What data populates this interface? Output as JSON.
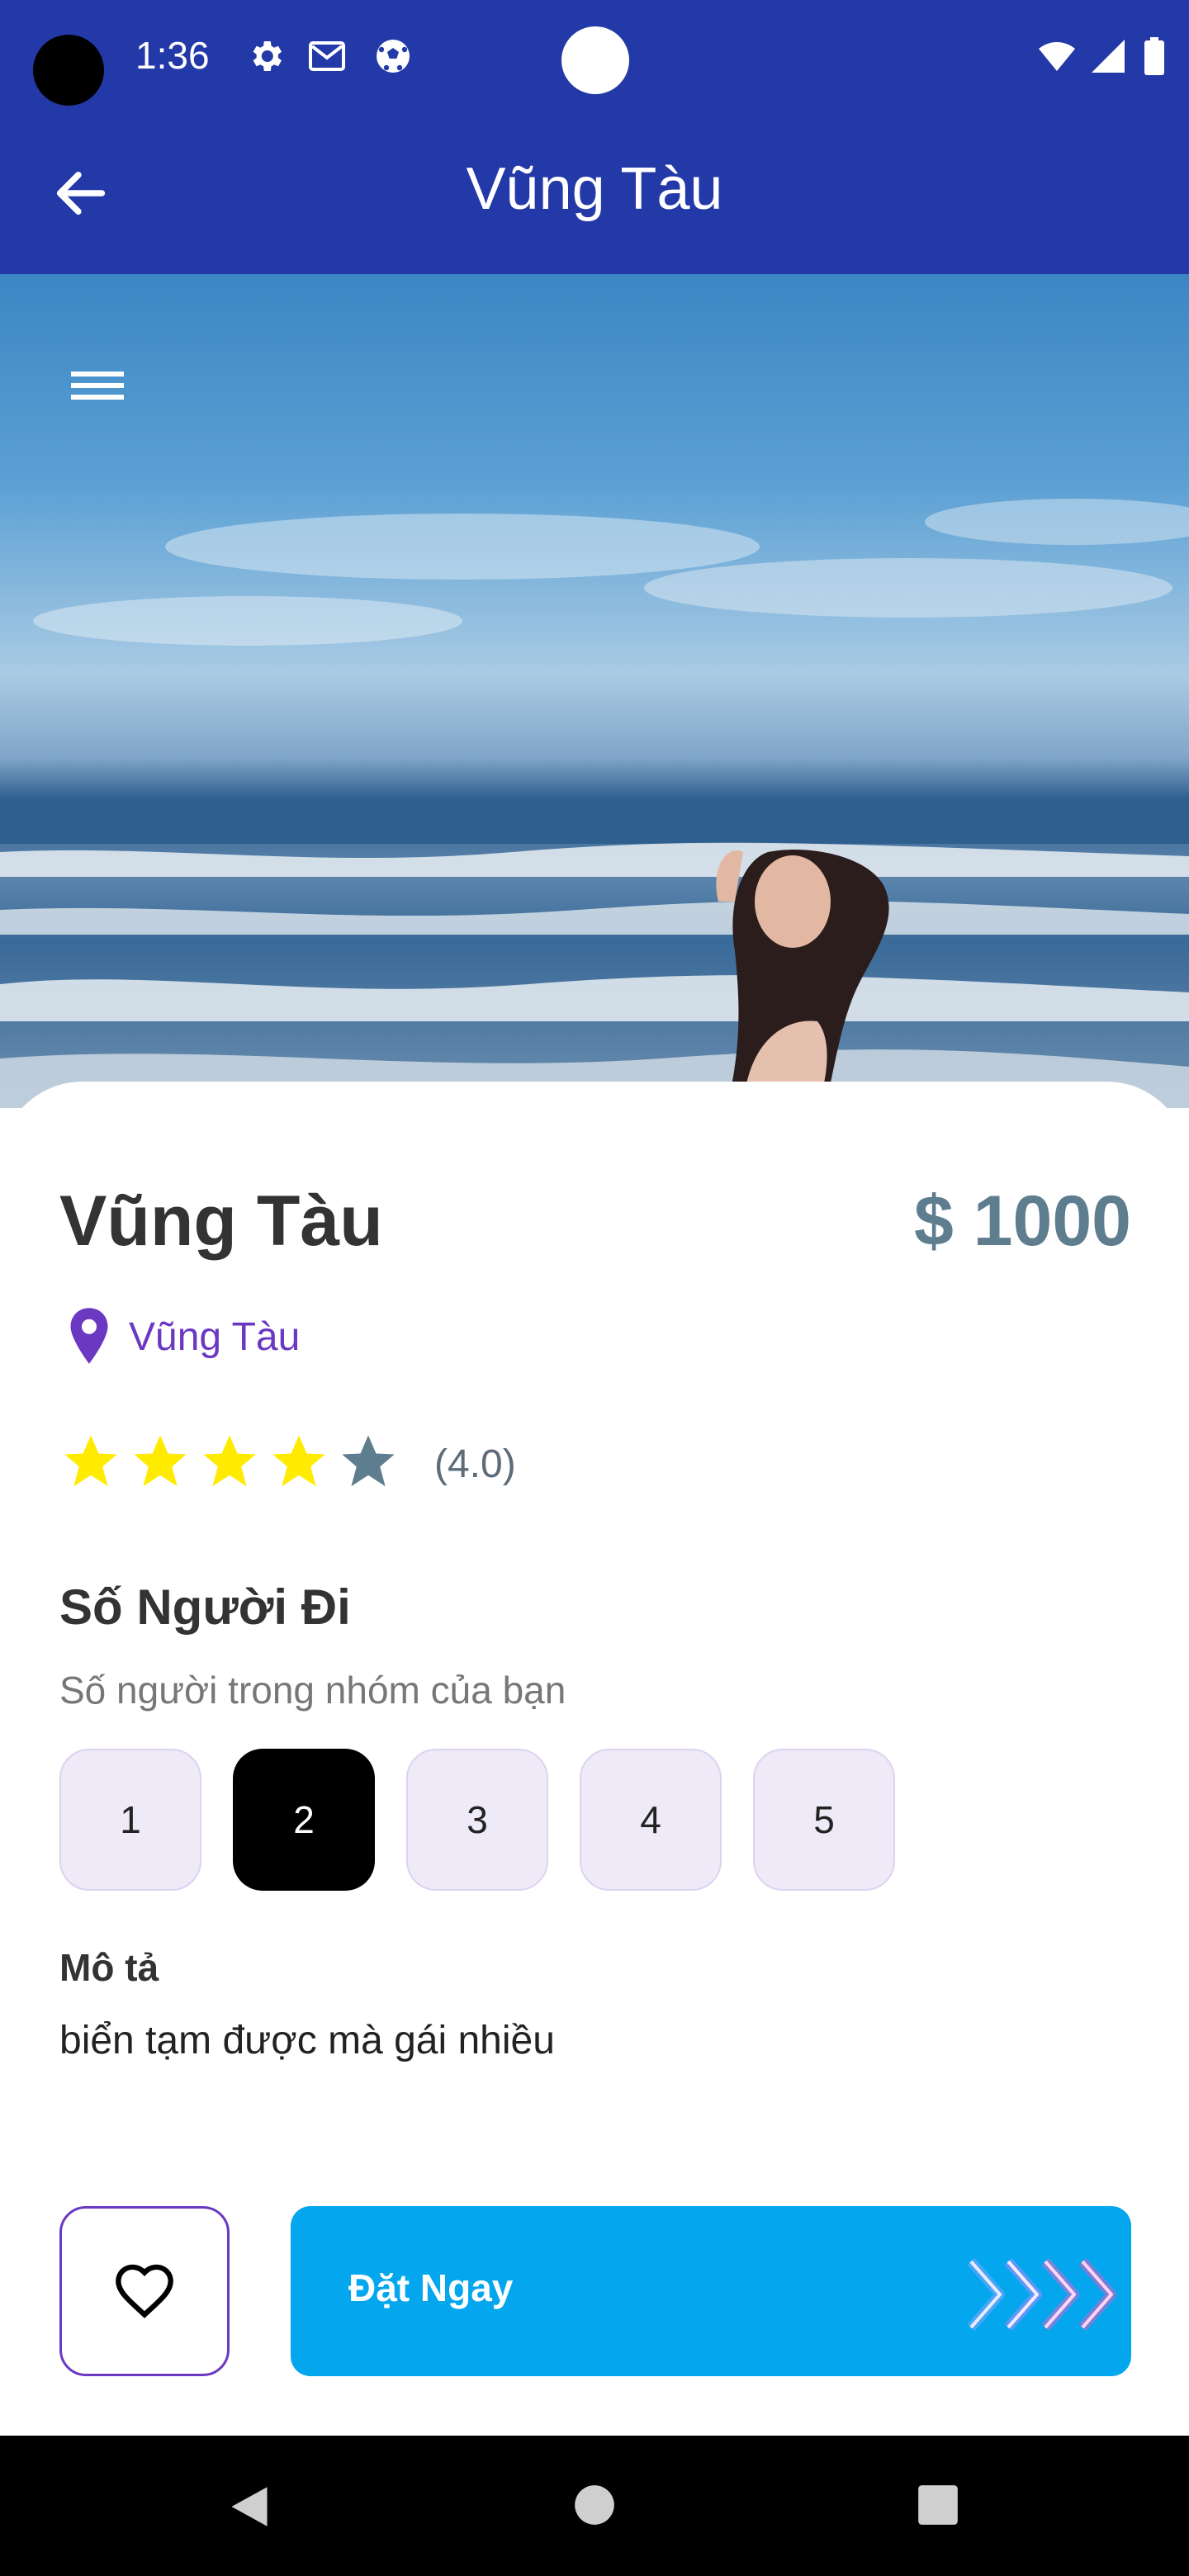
{
  "status_bar": {
    "time": "1:36",
    "icons": [
      "settings-icon",
      "gmail-icon",
      "soccer-ball-icon",
      "wifi-icon",
      "signal-icon",
      "battery-icon"
    ]
  },
  "app_bar": {
    "title": "Vũng Tàu",
    "back_icon": "arrow-back-icon"
  },
  "hero": {
    "menu_icon": "hamburger-menu-icon"
  },
  "details": {
    "title": "Vũng Tàu",
    "price": "$ 1000",
    "location": "Vũng Tàu",
    "rating_text": "(4.0)",
    "rating_value": 4,
    "rating_max": 5
  },
  "people": {
    "title": "Số Người Đi",
    "subtitle": "Số người trong nhóm của bạn",
    "options": [
      "1",
      "2",
      "3",
      "4",
      "5"
    ],
    "selected": "2"
  },
  "description": {
    "title": "Mô tả",
    "text": "biển tạm được mà gái nhiều"
  },
  "actions": {
    "favorite_icon": "heart-outline-icon",
    "book_label": "Đặt Ngay"
  },
  "colors": {
    "primary": "#2339a8",
    "accent": "#04a7ed",
    "location": "#6b38c2",
    "star_filled": "#ffeb00",
    "star_empty": "#5e7d8f"
  }
}
